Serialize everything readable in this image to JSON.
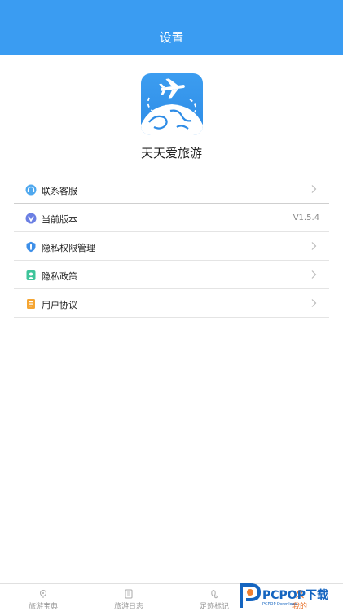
{
  "header": {
    "title": "设置"
  },
  "app": {
    "name": "天天爱旅游",
    "logo_icon": "airplane-globe-icon"
  },
  "menu": [
    {
      "label": "联系客服",
      "icon": "customer-service-icon",
      "value": ""
    },
    {
      "label": "当前版本",
      "icon": "version-icon",
      "value": "V1.5.4"
    },
    {
      "label": "隐私权限管理",
      "icon": "shield-icon",
      "value": ""
    },
    {
      "label": "隐私政策",
      "icon": "privacy-policy-icon",
      "value": ""
    },
    {
      "label": "用户协议",
      "icon": "document-icon",
      "value": ""
    }
  ],
  "tabbar": {
    "items": [
      {
        "label": "旅游宝典",
        "icon": "guide-icon"
      },
      {
        "label": "旅游日志",
        "icon": "journal-icon"
      },
      {
        "label": "足迹标记",
        "icon": "footprint-icon"
      },
      {
        "label": "我的",
        "icon": "profile-icon"
      }
    ],
    "active_index": 3
  },
  "watermark": {
    "text": "PCPOP下载",
    "sub": "PCPOP Download"
  },
  "colors": {
    "header": "#3a9cf2",
    "active_tab": "#e8742f"
  }
}
